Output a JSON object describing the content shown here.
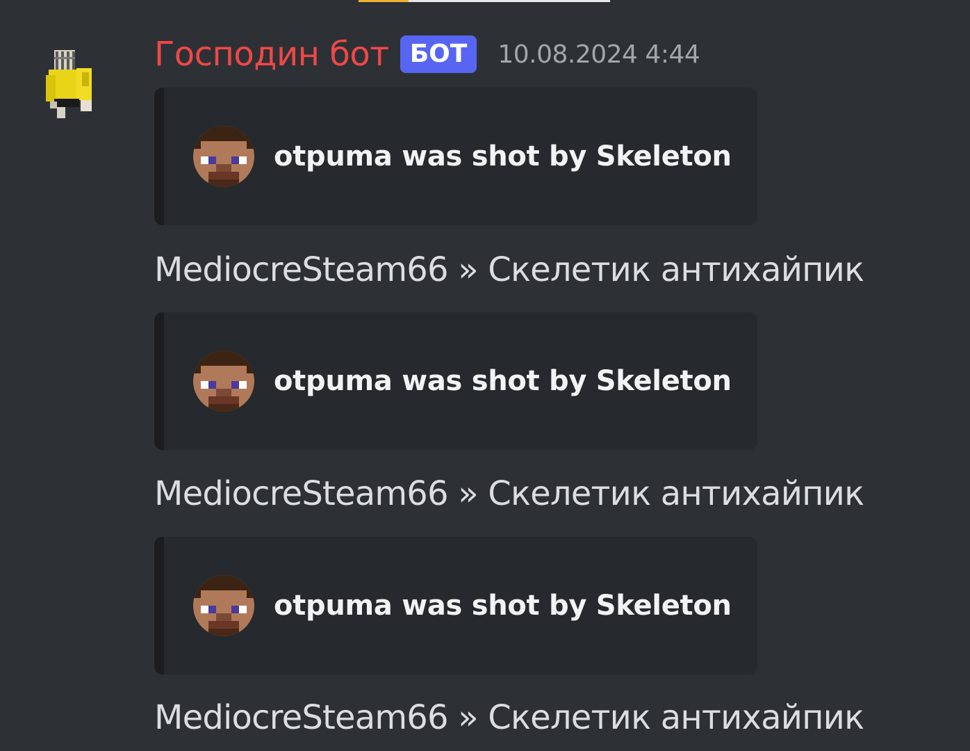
{
  "message": {
    "username": "Господин бот",
    "badge": "БОТ",
    "timestamp": "10.08.2024 4:44",
    "username_color": "#f04747",
    "badge_color": "#5865f2",
    "avatar_icon": "minecraft-character-avatar-icon"
  },
  "entries": [
    {
      "embed_author": "otpuma was shot by Skeleton",
      "embed_icon": "steve-head-icon",
      "chat_line": "MediocreSteam66 » Скелетик антихайпик"
    },
    {
      "embed_author": "otpuma was shot by Skeleton",
      "embed_icon": "steve-head-icon",
      "chat_line": "MediocreSteam66 » Скелетик антихайпик"
    },
    {
      "embed_author": "otpuma was shot by Skeleton",
      "embed_icon": "steve-head-icon",
      "chat_line": "MediocreSteam66 » Скелетик антихайпик"
    }
  ]
}
